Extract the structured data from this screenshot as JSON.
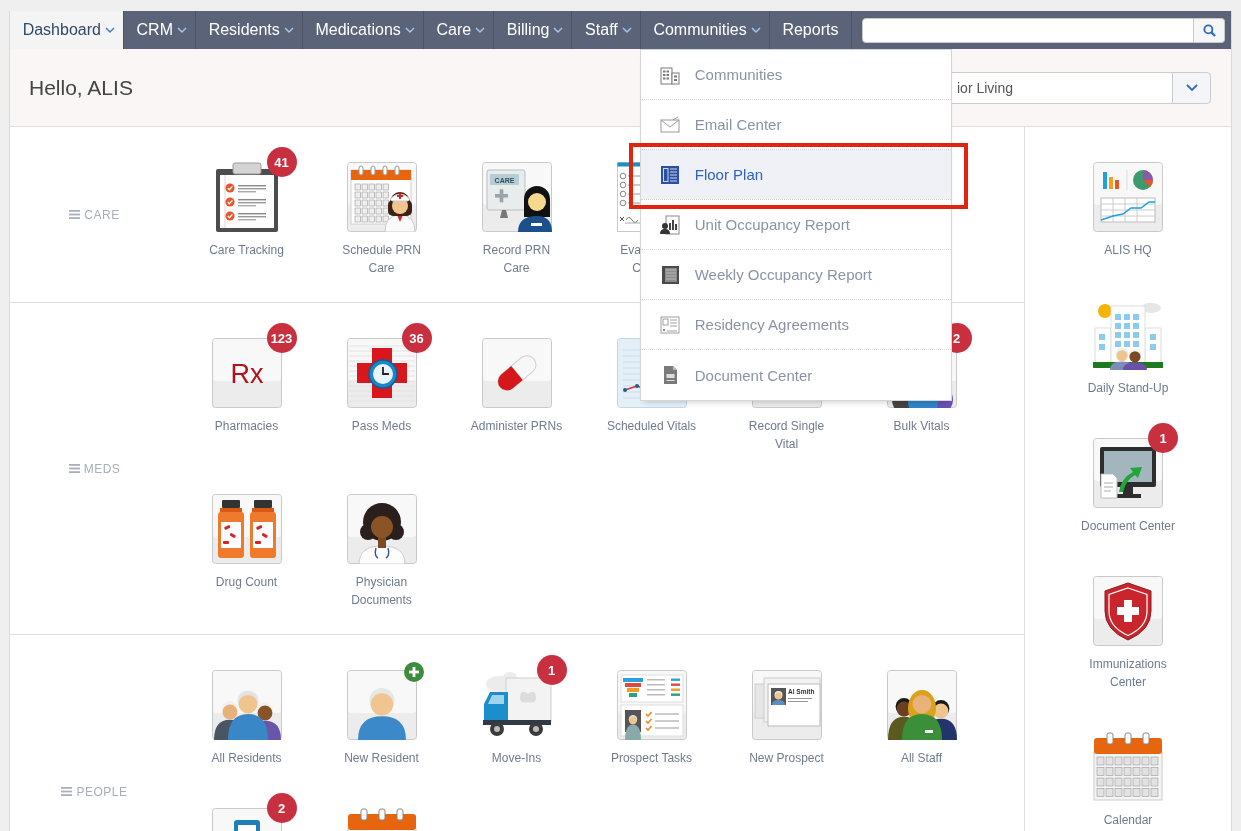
{
  "nav": {
    "tabs": [
      {
        "label": "Dashboard",
        "selected": true,
        "caret": true,
        "expanded": false
      },
      {
        "label": "CRM",
        "selected": false,
        "caret": true,
        "expanded": false
      },
      {
        "label": "Residents",
        "selected": false,
        "caret": true,
        "expanded": false
      },
      {
        "label": "Medications",
        "selected": false,
        "caret": true,
        "expanded": false
      },
      {
        "label": "Care",
        "selected": false,
        "caret": true,
        "expanded": false
      },
      {
        "label": "Billing",
        "selected": false,
        "caret": true,
        "expanded": false
      },
      {
        "label": "Staff",
        "selected": false,
        "caret": true,
        "expanded": false
      },
      {
        "label": "Communities",
        "selected": false,
        "caret": true,
        "expanded": true,
        "menu": [
          {
            "label": "Communities",
            "selected": false,
            "framed": false
          },
          {
            "label": "Email Center",
            "selected": false,
            "framed": false
          },
          {
            "label": "Floor Plan",
            "selected": true,
            "framed": true
          },
          {
            "label": "Unit Occupancy Report",
            "selected": false,
            "framed": false
          },
          {
            "label": "Weekly Occupancy Report",
            "selected": false,
            "framed": false
          },
          {
            "label": "Residency Agreements",
            "selected": false,
            "framed": false
          },
          {
            "label": "Document Center",
            "selected": false,
            "framed": false
          }
        ]
      },
      {
        "label": "Reports",
        "selected": false,
        "caret": false,
        "expanded": false
      }
    ]
  },
  "header": {
    "greeting": "Hello, ALIS",
    "community_select": {
      "value": "ior Living"
    }
  },
  "sections": [
    {
      "title": "CARE",
      "tiles": [
        {
          "kind": "full",
          "label": "Care Tracking",
          "badge": "41"
        },
        {
          "kind": "full",
          "label": "Schedule PRN Care"
        },
        {
          "kind": "full",
          "label": "Record PRN Care",
          "icon_text": "CARE"
        },
        {
          "kind": "cut",
          "label": "Eva C"
        }
      ]
    },
    {
      "title": "MEDS",
      "tiles": [
        {
          "kind": "full",
          "label": "Pharmacies",
          "badge": "123",
          "icon_text": "Rx"
        },
        {
          "kind": "full",
          "label": "Pass Meds",
          "badge": "36"
        },
        {
          "kind": "full",
          "label": "Administer PRNs"
        },
        {
          "kind": "full",
          "label": "Scheduled Vitals"
        },
        {
          "kind": "full",
          "label": "Record Single Vital"
        },
        {
          "kind": "full",
          "label": "Bulk Vitals",
          "badge": "2"
        },
        {
          "kind": "full",
          "label": "Drug Count"
        },
        {
          "kind": "full",
          "label": "Physician Documents"
        }
      ]
    },
    {
      "title": "PEOPLE",
      "tiles": [
        {
          "kind": "full",
          "label": "All Residents"
        },
        {
          "kind": "full",
          "label": "New Resident"
        },
        {
          "kind": "full",
          "label": "Move-Ins",
          "badge": "1"
        },
        {
          "kind": "full",
          "label": "Prospect Tasks"
        },
        {
          "kind": "full",
          "label": "New Prospect",
          "icon_text": "Al Smith"
        },
        {
          "kind": "full",
          "label": "All Staff"
        },
        {
          "kind": "full",
          "badge": "2"
        },
        {
          "kind": "full"
        }
      ]
    }
  ],
  "sidebar": {
    "items": [
      {
        "label": "ALIS HQ"
      },
      {
        "label": "Daily Stand-Up"
      },
      {
        "label": "Document Center",
        "badge": "1"
      },
      {
        "label": "Immunizations Center"
      },
      {
        "label": "Calendar"
      }
    ]
  }
}
